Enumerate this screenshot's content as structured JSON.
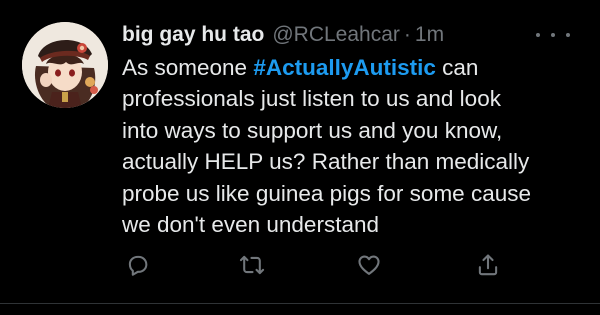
{
  "tweet": {
    "author": {
      "display_name": "big gay hu tao",
      "handle": "@RCLeahcar",
      "avatar_icon": "avatar-image"
    },
    "separator": "·",
    "timestamp": "1m",
    "more_icon": "more-icon",
    "text": {
      "line1_before": "As someone ",
      "hashtag": "#ActuallyAutistic",
      "line1_after": " can",
      "line2": "professionals just listen to us and look",
      "line3": "into ways to support us and you know,",
      "line4": "actually HELP us? Rather than medically",
      "line5": "probe us like guinea pigs for some cause",
      "line6": "we don't even understand"
    },
    "actions": [
      {
        "icon": "reply-icon"
      },
      {
        "icon": "retweet-icon"
      },
      {
        "icon": "like-icon"
      },
      {
        "icon": "share-icon"
      }
    ],
    "colors": {
      "background": "#000000",
      "text": "#e7e9ea",
      "secondary": "#71767b",
      "hashtag": "#1d9bf0"
    }
  }
}
